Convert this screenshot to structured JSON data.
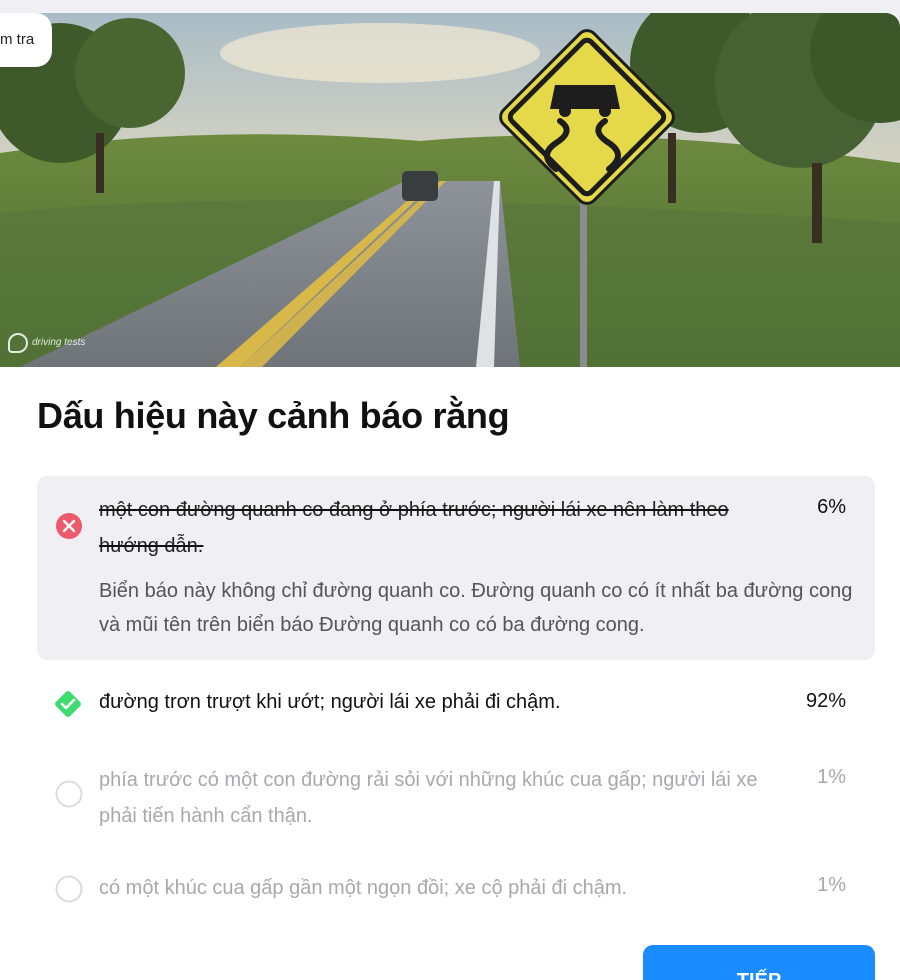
{
  "header": {
    "pill_label": "m tra"
  },
  "image": {
    "watermark": "driving tests",
    "description_icon": "slippery-road-sign"
  },
  "question": {
    "title": "Dấu hiệu này cảnh báo rằng"
  },
  "answers": [
    {
      "text": "một con đường quanh co đang ở phía trước; người lái xe nên làm theo hướng dẫn.",
      "percent": "6%",
      "state": "wrong",
      "explanation": "Biển báo này không chỉ đường quanh co. Đường quanh co có ít nhất ba đường cong và mũi tên trên biển báo Đường quanh co có ba đường cong."
    },
    {
      "text": "đường trơn trượt khi ướt; người lái xe phải đi chậm.",
      "percent": "92%",
      "state": "correct"
    },
    {
      "text": "phía trước có một con đường rải sỏi với những khúc cua gấp; người lái xe phải tiến hành cẩn thận.",
      "percent": "1%",
      "state": "unselected"
    },
    {
      "text": "có một khúc cua gấp gần một ngọn đồi; xe cộ phải đi chậm.",
      "percent": "1%",
      "state": "unselected"
    }
  ],
  "colors": {
    "wrong": "#ee5a6b",
    "correct": "#3ddc6f",
    "primary": "#1a8cff",
    "muted_text": "#a8a8ae"
  },
  "footer": {
    "next_label": "TIẾP"
  }
}
